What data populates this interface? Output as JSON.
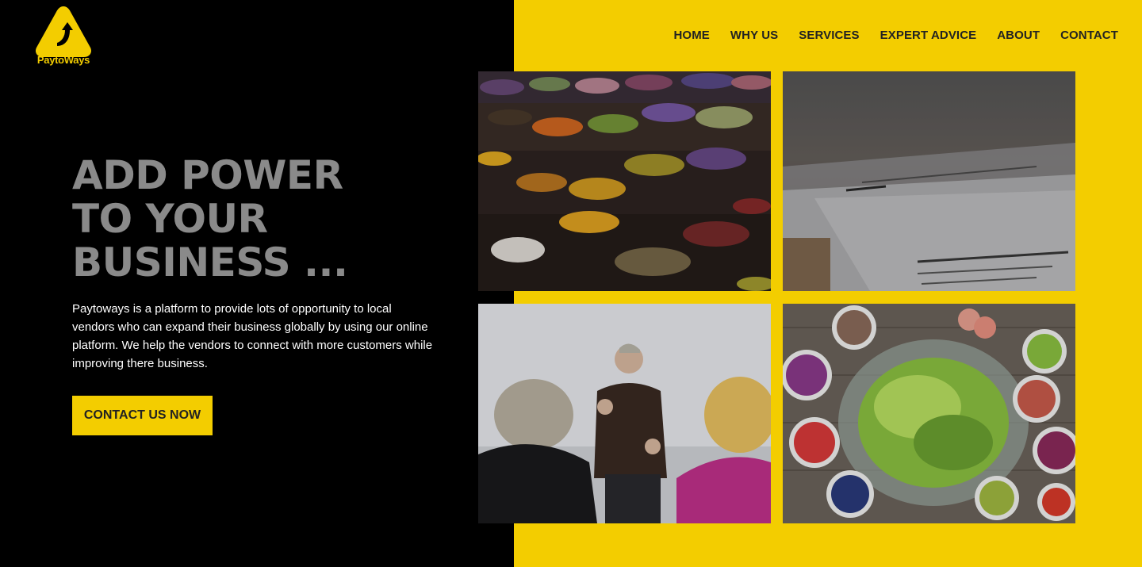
{
  "brand": {
    "name": "PaytoWays",
    "logo_color": "#f3cd00"
  },
  "nav": {
    "items": [
      {
        "label": "HOME"
      },
      {
        "label": "WHY US"
      },
      {
        "label": "SERVICES"
      },
      {
        "label": "EXPERT ADVICE"
      },
      {
        "label": "ABOUT"
      },
      {
        "label": "CONTACT"
      }
    ]
  },
  "hero": {
    "title_line1": "ADD POWER",
    "title_line2": "TO YOUR",
    "title_line3": "BUSINESS ...",
    "description": "Paytoways is a platform to provide lots of opportunity to local vendors who can expand their business globally by using our online platform. We help the vendors to connect with more customers while improving there business.",
    "cta_label": "CONTACT US NOW"
  },
  "colors": {
    "accent": "#f3cd00",
    "dark": "#000000",
    "title_gray": "#8a8a8a"
  }
}
